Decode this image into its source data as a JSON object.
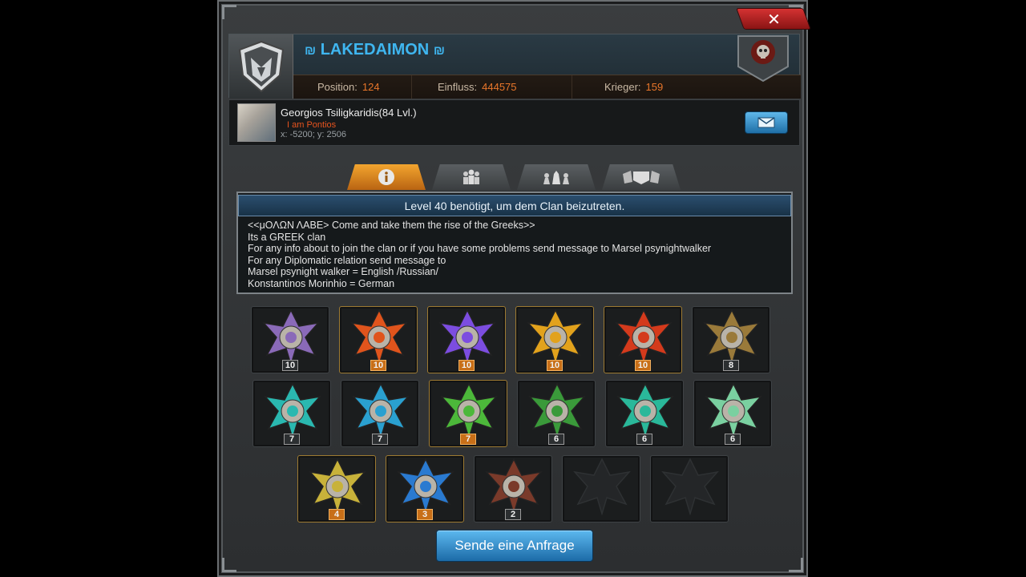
{
  "window": {
    "close_label": "✕",
    "accent": "#3fb6f0"
  },
  "clan": {
    "ornament_left": "₪",
    "name": "LAKEDAIMON",
    "ornament_right": "₪",
    "stats": [
      {
        "label": "Position:",
        "value": "124"
      },
      {
        "label": "Einfluss:",
        "value": "444575"
      },
      {
        "label": "Krieger:",
        "value": "159"
      }
    ]
  },
  "leader": {
    "name": "Georgios Tsiligkaridis(84 Lvl.)",
    "motto": "I am Pontios",
    "coords": "x: -5200; y: 2506"
  },
  "tabs": [
    {
      "icon": "info-icon",
      "active": true
    },
    {
      "icon": "members-icon",
      "active": false
    },
    {
      "icon": "chess-icon",
      "active": false
    },
    {
      "icon": "alliance-icon",
      "active": false
    }
  ],
  "info": {
    "requirement": "Level 40 benötigt, um dem Clan beizutreten.",
    "description": "<<μΟΛΩΝ ΛΑΒΕ> Come and take them the rise of the Greeks>>\nIts a GREEK clan\nFor any info about  to join the clan or if you have some problems send message to Marsel psynightwalker\nFor any Diplomatic relation send message  to\nMarsel psynight walker = English /Russian/\nKonstantinos Morinhio = German"
  },
  "medals": [
    [
      {
        "name": "medal-mech-skull",
        "count": "10",
        "color": "#8a6ab8",
        "gold": false,
        "orange": false
      },
      {
        "name": "medal-fire-skull",
        "count": "10",
        "color": "#e0541c",
        "gold": true,
        "orange": true
      },
      {
        "name": "medal-purple-skull",
        "count": "10",
        "color": "#7c4de0",
        "gold": true,
        "orange": true
      },
      {
        "name": "medal-gold-skull",
        "count": "10",
        "color": "#e2a21c",
        "gold": true,
        "orange": true
      },
      {
        "name": "medal-red-star",
        "count": "10",
        "color": "#d43a1c",
        "gold": true,
        "orange": true
      },
      {
        "name": "medal-bronze-wings",
        "count": "8",
        "color": "#9a7a3a",
        "gold": false,
        "orange": false
      }
    ],
    [
      {
        "name": "medal-teal-star",
        "count": "7",
        "color": "#2ab8b0",
        "gold": false,
        "orange": false
      },
      {
        "name": "medal-cyan-helmet",
        "count": "7",
        "color": "#2aa0d0",
        "gold": false,
        "orange": false
      },
      {
        "name": "medal-green-star",
        "count": "7",
        "color": "#4cb83a",
        "gold": true,
        "orange": true
      },
      {
        "name": "medal-green-soldier",
        "count": "6",
        "color": "#3a9a3a",
        "gold": false,
        "orange": false
      },
      {
        "name": "medal-teal-shield",
        "count": "6",
        "color": "#2ab89a",
        "gold": false,
        "orange": false
      },
      {
        "name": "medal-silver-skull",
        "count": "6",
        "color": "#7ad0a0",
        "gold": false,
        "orange": false
      }
    ],
    [
      {
        "name": "medal-gold-compass",
        "count": "4",
        "color": "#c8b23a",
        "gold": true,
        "orange": true
      },
      {
        "name": "medal-blue-trophy",
        "count": "3",
        "color": "#2a7ad0",
        "gold": true,
        "orange": true
      },
      {
        "name": "medal-eagle-shield",
        "count": "2",
        "color": "#7a3a2a",
        "gold": false,
        "orange": false
      },
      {
        "name": "medal-locked-sun",
        "count": "",
        "color": "#1f2122",
        "gold": false,
        "orange": false
      },
      {
        "name": "medal-locked-eagle",
        "count": "",
        "color": "#1f2122",
        "gold": false,
        "orange": false
      }
    ]
  ],
  "send_request_label": "Sende eine Anfrage"
}
